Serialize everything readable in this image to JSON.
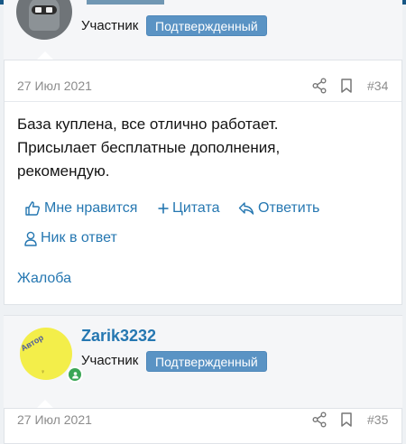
{
  "post1": {
    "author_role": "Участник",
    "author_badge": "Подтвержденный",
    "date": "27 Июл 2021",
    "number": "#34",
    "body_lines": [
      "База куплена, все отлично работает.",
      "Присылает бесплатные дополнения,",
      "рекомендую."
    ],
    "actions": {
      "like": "Мне нравится",
      "quote": "Цитата",
      "reply": "Ответить",
      "mention": "Ник в ответ",
      "report": "Жалоба"
    }
  },
  "post2": {
    "username": "Zarik3232",
    "author_role": "Участник",
    "author_badge": "Подтвержденный",
    "avatar_text": "Автор",
    "date": "27 Июл 2021",
    "number": "#35"
  },
  "colors": {
    "accent": "#2577b1",
    "badge": "#5a93c4",
    "online": "#3aa655",
    "header": "#185886"
  },
  "icons": [
    "share-icon",
    "bookmark-icon",
    "thumbs-up-icon",
    "plus-icon",
    "reply-icon",
    "user-icon",
    "online-indicator-icon"
  ]
}
